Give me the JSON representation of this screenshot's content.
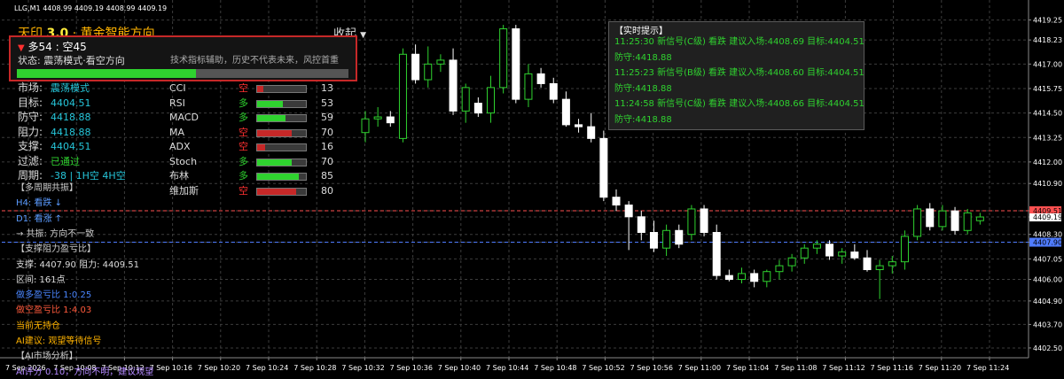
{
  "window": {
    "title": "LLG,M1  4408.99 4409.19 4408.99 4409.19"
  },
  "header": {
    "title_prefix": "天印",
    "title_version": "3.0",
    "title_suffix": "· 黄金智能方向",
    "collapse_label": "收起",
    "collapse_arrow": "▼"
  },
  "panel": {
    "ratio": "多54 : 空45",
    "arrow": "▼",
    "status": "状态: 震荡模式·看空方向",
    "disclaimer": "技术指标辅助，历史不代表未来，风控首重",
    "progress": 0.54
  },
  "left_rows": [
    {
      "label": "市场:",
      "value": "震荡模式",
      "color": "#26c6da"
    },
    {
      "label": "目标:",
      "value": "4404.51",
      "color": "#26c6da"
    },
    {
      "label": "防守:",
      "value": "4418.88",
      "color": "#26c6da"
    },
    {
      "label": "阻力:",
      "value": "4418.88",
      "color": "#26c6da"
    },
    {
      "label": "支撑:",
      "value": "4404.51",
      "color": "#26c6da"
    },
    {
      "label": "过滤:",
      "value": "已通过",
      "color": "#2fd22f"
    },
    {
      "label": "周期:",
      "value": "-38 | 1H空 4H空",
      "color": "#26c6da"
    }
  ],
  "indicators": [
    {
      "name": "CCI",
      "dir": "空",
      "dir_color": "#ff3030",
      "value": "13",
      "level": 0.13,
      "fill": "#c62828"
    },
    {
      "name": "RSI",
      "dir": "多",
      "dir_color": "#2fd22f",
      "value": "53",
      "level": 0.53,
      "fill": "#2fd22f"
    },
    {
      "name": "MACD",
      "dir": "多",
      "dir_color": "#2fd22f",
      "value": "59",
      "level": 0.59,
      "fill": "#2fd22f"
    },
    {
      "name": "MA",
      "dir": "空",
      "dir_color": "#ff3030",
      "value": "70",
      "level": 0.7,
      "fill": "#c62828"
    },
    {
      "name": "ADX",
      "dir": "空",
      "dir_color": "#ff3030",
      "value": "16",
      "level": 0.16,
      "fill": "#c62828"
    },
    {
      "name": "Stoch",
      "dir": "多",
      "dir_color": "#2fd22f",
      "value": "70",
      "level": 0.7,
      "fill": "#2fd22f"
    },
    {
      "name": "布林",
      "dir": "多",
      "dir_color": "#2fd22f",
      "value": "85",
      "level": 0.85,
      "fill": "#2fd22f"
    },
    {
      "name": "维加斯",
      "dir": "空",
      "dir_color": "#ff3030",
      "value": "80",
      "level": 0.8,
      "fill": "#c62828"
    }
  ],
  "lines": [
    {
      "text": "【多周期共振】",
      "color": "#cccccc"
    },
    {
      "text": "H4: 看跌 ↓",
      "color": "#5b9bff"
    },
    {
      "text": "D1: 看涨 ↑",
      "color": "#5b9bff"
    },
    {
      "text": "→ 共振: 方向不一致",
      "color": "#cccccc"
    },
    {
      "text": "【支撑阻力盈亏比】",
      "color": "#cccccc"
    },
    {
      "text": "支撑: 4407.90  阻力: 4409.51",
      "color": "#dddddd"
    },
    {
      "text": "区间: 161点",
      "color": "#dddddd"
    },
    {
      "text": "做多盈亏比 1:0.25",
      "color": "#4a86ff"
    },
    {
      "text": "做空盈亏比 1:4.03",
      "color": "#ff5a3c"
    },
    {
      "text": "当前无持仓",
      "color": "#ffb300"
    },
    {
      "text": "AI建议: 观望等待信号",
      "color": "#ffb300"
    },
    {
      "text": "【AI市场分析】",
      "color": "#cccccc"
    },
    {
      "text": "AI评分 0.10，方向不明，建议观望",
      "color": "#b388ff"
    }
  ],
  "tooltip": {
    "title": "【实时提示】",
    "items": [
      "11:25:30 新信号(C级) 看跌 建议入场:4408.69 目标:4404.51",
      "防守:4418.88",
      "11:25:23 新信号(B级) 看跌 建议入场:4408.60 目标:4404.51",
      "防守:4418.88",
      "11:24:58 新信号(C级) 看跌 建议入场:4408.66 目标:4404.51",
      "防守:4418.88"
    ]
  },
  "chart_data": {
    "type": "candlestick",
    "colors": {
      "bull": "#2fd22f",
      "bear": "#ffffff",
      "grid": "#3c3c3c",
      "axis_text": "#ffffff"
    },
    "y_range": [
      4402.0,
      4420.0
    ],
    "y_ticks": [
      4419.25,
      4418.23,
      4417.0,
      4415.75,
      4414.5,
      4413.25,
      4412.0,
      4410.9,
      4409.51,
      4409.19,
      4408.3,
      4407.9,
      4407.05,
      4406.0,
      4404.9,
      4403.7,
      4402.5
    ],
    "x_ticks": [
      "7 Sep 2026",
      "7 Sep 10:08",
      "7 Sep 10:12",
      "7 Sep 10:16",
      "7 Sep 10:20",
      "7 Sep 10:24",
      "7 Sep 10:28",
      "7 Sep 10:32",
      "7 Sep 10:36",
      "7 Sep 10:40",
      "7 Sep 10:44",
      "7 Sep 10:48",
      "7 Sep 10:52",
      "7 Sep 10:56",
      "7 Sep 11:00",
      "7 Sep 11:04",
      "7 Sep 11:08",
      "7 Sep 11:12",
      "7 Sep 11:16",
      "7 Sep 11:20",
      "7 Sep 11:24"
    ],
    "hlines": [
      {
        "value": 4409.51,
        "color": "#ff5050",
        "label": "4409.51"
      },
      {
        "value": 4407.9,
        "color": "#4f7cff",
        "label": "4407.90"
      }
    ],
    "price_tag": {
      "value": 4409.19,
      "label": "4409.19"
    },
    "candles": [
      [
        4413.5,
        4414.6,
        4413.0,
        4414.2
      ],
      [
        4414.2,
        4414.8,
        4413.8,
        4414.3
      ],
      [
        4414.3,
        4414.6,
        4413.8,
        4414.0
      ],
      [
        4413.2,
        4417.8,
        4413.0,
        4417.5
      ],
      [
        4417.5,
        4418.0,
        4416.0,
        4416.2
      ],
      [
        4416.2,
        4417.9,
        4415.8,
        4417.0
      ],
      [
        4417.0,
        4417.5,
        4416.6,
        4417.2
      ],
      [
        4417.2,
        4417.8,
        4414.4,
        4414.6
      ],
      [
        4414.6,
        4416.0,
        4414.0,
        4415.8
      ],
      [
        4415.0,
        4415.3,
        4414.3,
        4414.5
      ],
      [
        4414.5,
        4416.4,
        4414.0,
        4415.8
      ],
      [
        4415.8,
        4419.0,
        4415.5,
        4418.8
      ],
      [
        4418.8,
        4419.0,
        4415.0,
        4415.2
      ],
      [
        4415.2,
        4417.0,
        4414.8,
        4416.5
      ],
      [
        4416.5,
        4416.8,
        4415.8,
        4416.0
      ],
      [
        4416.0,
        4416.3,
        4415.0,
        4415.2
      ],
      [
        4415.2,
        4415.6,
        4413.8,
        4413.9
      ],
      [
        4413.9,
        4414.2,
        4413.5,
        4413.8
      ],
      [
        4413.8,
        4414.5,
        4413.0,
        4413.2
      ],
      [
        4413.2,
        4413.6,
        4410.0,
        4410.2
      ],
      [
        4410.2,
        4410.6,
        4409.5,
        4409.8
      ],
      [
        4409.8,
        4410.0,
        4407.5,
        4409.2
      ],
      [
        4409.2,
        4409.5,
        4408.0,
        4408.4
      ],
      [
        4408.4,
        4409.0,
        4407.4,
        4407.6
      ],
      [
        4407.6,
        4408.8,
        4407.2,
        4408.5
      ],
      [
        4408.5,
        4408.8,
        4407.6,
        4407.8
      ],
      [
        4408.3,
        4409.8,
        4408.0,
        4409.6
      ],
      [
        4409.6,
        4409.8,
        4408.2,
        4408.4
      ],
      [
        4408.4,
        4408.8,
        4406.0,
        4406.2
      ],
      [
        4406.2,
        4406.5,
        4405.9,
        4406.0
      ],
      [
        4406.0,
        4406.6,
        4405.8,
        4406.3
      ],
      [
        4406.3,
        4406.5,
        4405.6,
        4405.9
      ],
      [
        4405.9,
        4406.5,
        4405.6,
        4406.4
      ],
      [
        4406.4,
        4407.0,
        4406.0,
        4406.7
      ],
      [
        4406.7,
        4407.3,
        4406.4,
        4407.1
      ],
      [
        4407.1,
        4407.8,
        4406.8,
        4407.6
      ],
      [
        4407.6,
        4408.0,
        4407.3,
        4407.8
      ],
      [
        4407.8,
        4408.0,
        4407.0,
        4407.2
      ],
      [
        4407.2,
        4407.6,
        4406.8,
        4407.4
      ],
      [
        4407.4,
        4407.8,
        4407.0,
        4407.1
      ],
      [
        4407.1,
        4407.5,
        4406.4,
        4406.5
      ],
      [
        4406.5,
        4407.0,
        4405.0,
        4406.7
      ],
      [
        4406.7,
        4407.2,
        4406.3,
        4406.9
      ],
      [
        4406.9,
        4408.5,
        4406.5,
        4408.2
      ],
      [
        4408.2,
        4409.8,
        4408.0,
        4409.6
      ],
      [
        4409.6,
        4409.9,
        4408.5,
        4408.7
      ],
      [
        4408.7,
        4409.8,
        4408.5,
        4409.5
      ],
      [
        4409.5,
        4409.7,
        4408.3,
        4408.5
      ],
      [
        4408.5,
        4409.6,
        4408.3,
        4409.4
      ],
      [
        4409.0,
        4409.4,
        4408.8,
        4409.19
      ]
    ]
  }
}
